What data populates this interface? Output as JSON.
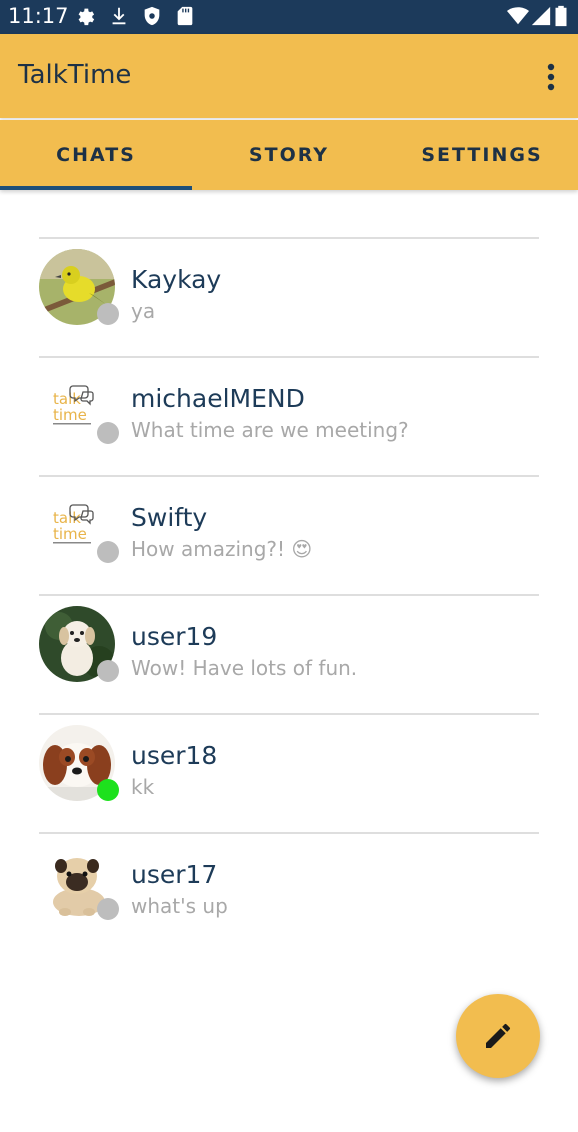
{
  "status_bar": {
    "time": "11:17",
    "icons": [
      "gear-icon",
      "download-icon",
      "shield-icon",
      "sd-card-icon",
      "wifi-icon",
      "signal-icon",
      "battery-icon"
    ]
  },
  "app_bar": {
    "title": "TalkTime",
    "menu_icon": "more-vert-icon"
  },
  "tabs": [
    {
      "label": "CHATS",
      "active": true
    },
    {
      "label": "STORY",
      "active": false
    },
    {
      "label": "SETTINGS",
      "active": false
    }
  ],
  "chats": [
    {
      "name": "Kaykay",
      "message": "ya",
      "avatar": "bird-photo",
      "online": false
    },
    {
      "name": "michaelMEND",
      "message": "What time are we meeting?",
      "avatar": "talktime-logo",
      "online": false
    },
    {
      "name": "Swifty",
      "message": "How amazing?! 😍",
      "avatar": "talktime-logo",
      "online": false
    },
    {
      "name": "user19",
      "message": "Wow! Have lots of fun.",
      "avatar": "puppy-photo",
      "online": false
    },
    {
      "name": "user18",
      "message": "kk",
      "avatar": "spaniel-photo",
      "online": true
    },
    {
      "name": "user17",
      "message": "what's up",
      "avatar": "pug-photo",
      "online": false
    }
  ],
  "logo_text": [
    "talk",
    "time"
  ],
  "fab": {
    "icon": "pencil-icon"
  },
  "colors": {
    "status_bar": "#1c3a5b",
    "primary": "#f2bd4f",
    "text_dark": "#1d3b58",
    "online": "#1de11d",
    "offline": "#bdbdbd"
  }
}
